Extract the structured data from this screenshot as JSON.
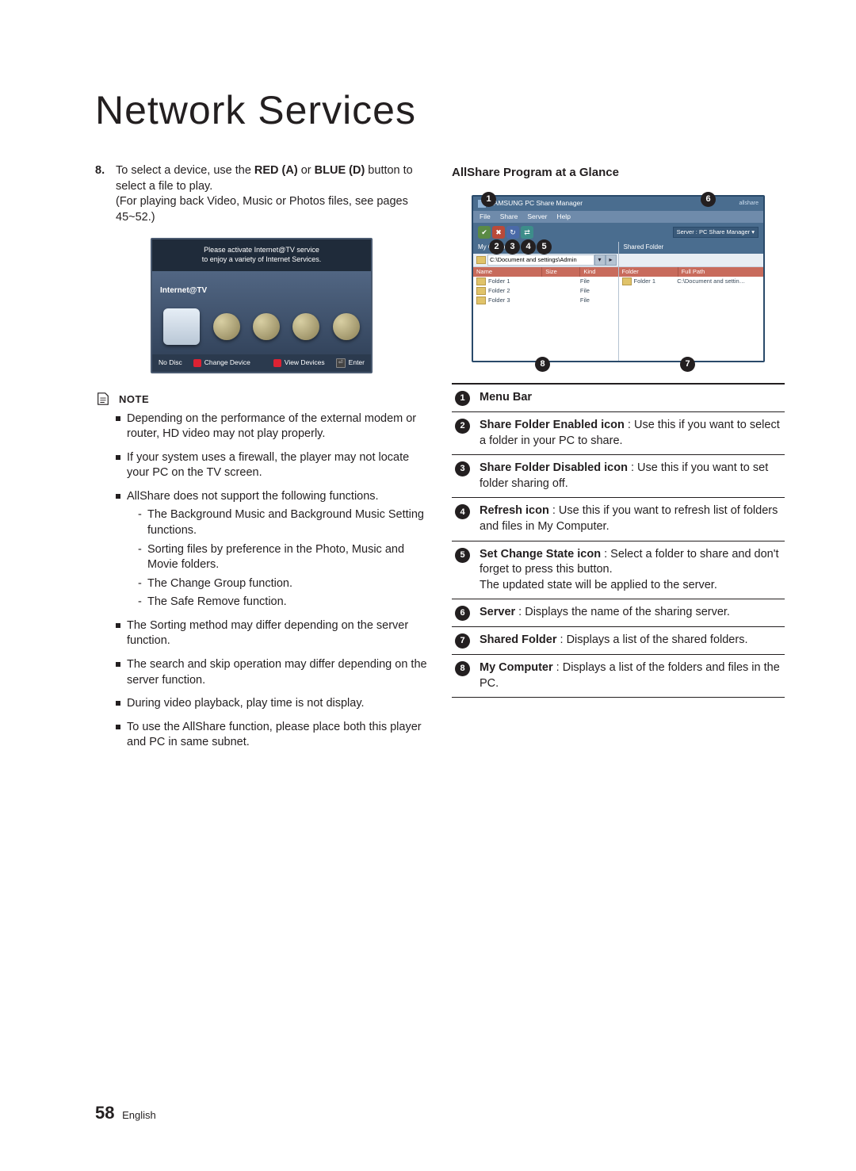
{
  "title": "Network Services",
  "left": {
    "step": {
      "num": "8.",
      "text": "To select a device, use the ",
      "red": "RED (A)",
      "mid": " or ",
      "blue": "BLUE (D)",
      "after": " button to select a file to play.",
      "para2": "(For playing back Video, Music or Photos files, see pages 45~52.)"
    },
    "tv": {
      "banner1": "Please activate Internet@TV service",
      "banner2": "to enjoy a variety of Internet Services.",
      "label": "Internet@TV",
      "noDisc": "No Disc",
      "changeDevice": "Change Device",
      "viewDevices": "View Devices",
      "enter": "Enter"
    },
    "noteHead": "NOTE",
    "notes": [
      "Depending on the performance of the external modem or router, HD video may not play properly.",
      "If your system uses a firewall, the player may not locate your PC on the TV screen.",
      "AllShare does not support the following functions.",
      "The Sorting method may differ depending on the server function.",
      "The search and skip operation may differ depending on the server function.",
      "During video playback, play time is not display.",
      "To use the AllShare function, please place both this player and PC in same subnet."
    ],
    "subnotes": [
      "The Background Music and Background Music Setting functions.",
      "Sorting files by preference in the Photo, Music and Movie folders.",
      "The Change Group function.",
      "The Safe Remove function."
    ]
  },
  "right": {
    "heading": "AllShare Program at a Glance",
    "app": {
      "title": "SAMSUNG PC Share Manager",
      "menu": [
        "File",
        "Share",
        "Server",
        "Help"
      ],
      "serverLabel": "Server : PC Share Manager ▾",
      "leftHead": "My Computer",
      "rightHead": "Shared Folder",
      "path": "C:\\Document and settings\\Admin",
      "colsL": [
        "Name",
        "Size",
        "Kind"
      ],
      "colsR": [
        "Folder",
        "Full Path"
      ],
      "rowsL": [
        {
          "name": "Folder 1",
          "size": "",
          "kind": "File"
        },
        {
          "name": "Folder 2",
          "size": "",
          "kind": "File"
        },
        {
          "name": "Folder 3",
          "size": "",
          "kind": "File"
        }
      ],
      "rowsR": [
        {
          "folder": "Folder 1",
          "path": "C:\\Document and settin…"
        }
      ]
    },
    "legend": [
      {
        "n": "1",
        "bold": "Menu Bar",
        "text": ""
      },
      {
        "n": "2",
        "bold": "Share Folder Enabled icon",
        "text": " : Use this if you want to select a folder in your PC to share."
      },
      {
        "n": "3",
        "bold": "Share Folder Disabled icon",
        "text": " : Use this if you want to set folder sharing off."
      },
      {
        "n": "4",
        "bold": "Refresh icon",
        "text": " : Use this if you want to refresh list of folders and files in My Computer."
      },
      {
        "n": "5",
        "bold": "Set Change State icon",
        "text": " : Select a folder to share and don't forget to press this button.\nThe updated state will be applied to the server."
      },
      {
        "n": "6",
        "bold": "Server",
        "text": " : Displays the name of the sharing server."
      },
      {
        "n": "7",
        "bold": "Shared Folder",
        "text": " : Displays a list of the shared folders."
      },
      {
        "n": "8",
        "bold": "My Computer",
        "text": " : Displays a list of the folders and files in the PC."
      }
    ]
  },
  "footer": {
    "page": "58",
    "lang": "English"
  }
}
